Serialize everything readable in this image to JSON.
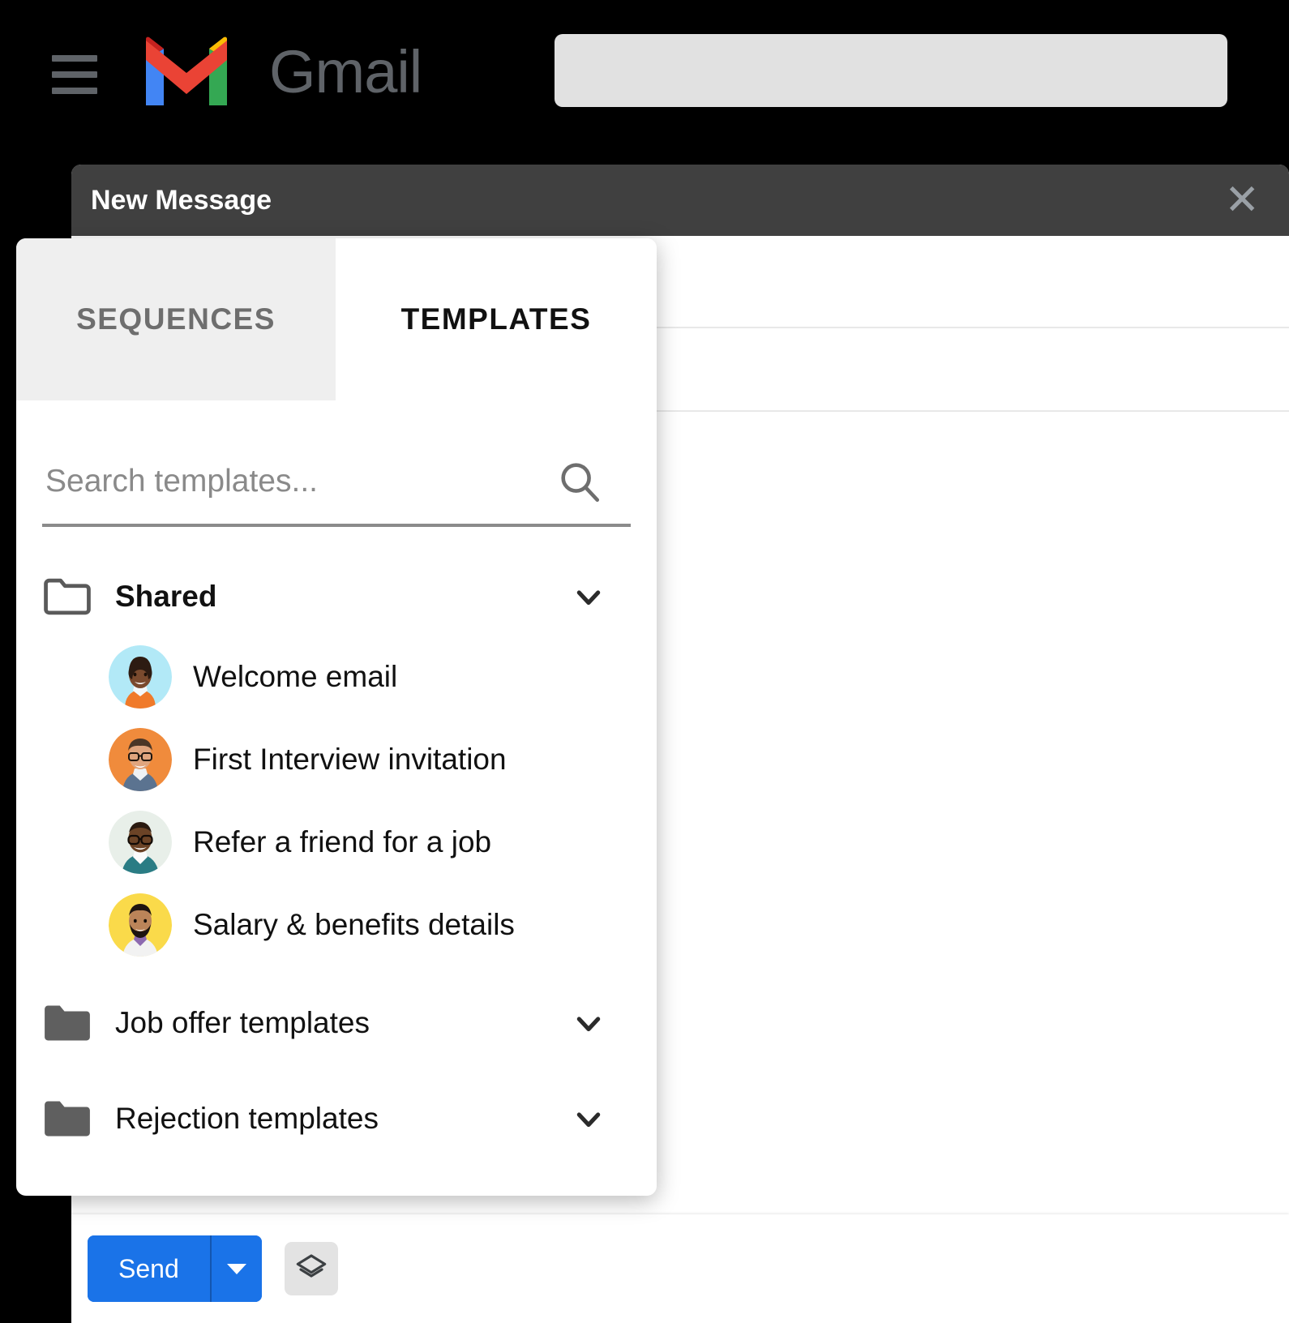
{
  "app": {
    "brand": "Gmail",
    "menu_icon": "hamburger-icon",
    "search_placeholder": "",
    "search_value": ""
  },
  "compose": {
    "title": "New Message",
    "close_icon": "close-icon",
    "to_value": "",
    "subject_value": "",
    "body_value": "",
    "toolbar": {
      "send_label": "Send",
      "send_caret_icon": "chevron-down-icon",
      "templates_icon": "layers-icon",
      "send_color": "#1a73e8"
    }
  },
  "templates_panel": {
    "tabs": [
      {
        "label": "SEQUENCES",
        "active": false
      },
      {
        "label": "TEMPLATES",
        "active": true
      }
    ],
    "search": {
      "placeholder": "Search templates...",
      "value": "",
      "icon": "search-icon"
    },
    "folders": [
      {
        "name": "Shared",
        "bold": true,
        "expanded": true,
        "chevron_icon": "chevron-down-icon",
        "folder_icon": "folder-outline-icon",
        "items": [
          {
            "label": "Welcome email",
            "avatar": "avatar-woman-afro",
            "avatar_bg": "#b2e9f7"
          },
          {
            "label": "First Interview invitation",
            "avatar": "avatar-man-glasses-orange",
            "avatar_bg": "#f08b3c"
          },
          {
            "label": "Refer a friend for a job",
            "avatar": "avatar-man-glasses-teal",
            "avatar_bg": "#e8efe9"
          },
          {
            "label": "Salary & benefits details",
            "avatar": "avatar-man-beard-yellow",
            "avatar_bg": "#fada4a"
          }
        ]
      },
      {
        "name": "Job offer templates",
        "bold": false,
        "expanded": false,
        "chevron_icon": "chevron-down-icon",
        "folder_icon": "folder-filled-icon",
        "items": []
      },
      {
        "name": "Rejection templates",
        "bold": false,
        "expanded": false,
        "chevron_icon": "chevron-down-icon",
        "folder_icon": "folder-filled-icon",
        "items": []
      }
    ]
  },
  "colors": {
    "gmail_red": "#ea4335",
    "gmail_blue": "#4285f4",
    "gmail_green": "#34a853",
    "gmail_yellow": "#fbbc04",
    "gmail_dark_red": "#c5221f",
    "header_gray": "#5f6368",
    "compose_bar": "#404040",
    "accent": "#1a73e8"
  }
}
